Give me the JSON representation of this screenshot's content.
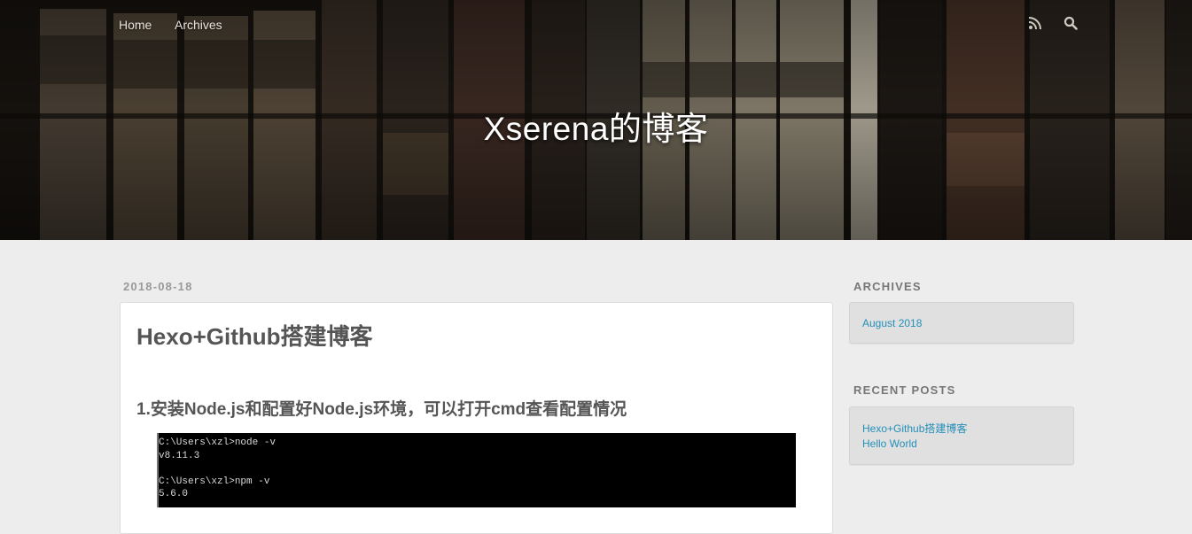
{
  "nav": {
    "home": "Home",
    "archives": "Archives",
    "rss_icon": "rss-icon",
    "search_icon": "search-icon"
  },
  "banner": {
    "site_title": "Xserena的博客"
  },
  "post": {
    "date": "2018-08-18",
    "title": "Hexo+Github搭建博客",
    "heading": "1.安装Node.js和配置好Node.js环境，可以打开cmd查看配置情况",
    "cmd_lines": [
      "C:\\Users\\xzl>node -v",
      "v8.11.3",
      "",
      "C:\\Users\\xzl>npm -v",
      "5.6.0"
    ]
  },
  "sidebar": {
    "archives_title": "ARCHIVES",
    "archives": [
      "August 2018"
    ],
    "recent_title": "RECENT POSTS",
    "recent": [
      "Hexo+Github搭建博客",
      "Hello World"
    ]
  },
  "colors": {
    "link": "#258fb8",
    "page_bg": "#ededed",
    "banner_bg": "#1a1612"
  }
}
